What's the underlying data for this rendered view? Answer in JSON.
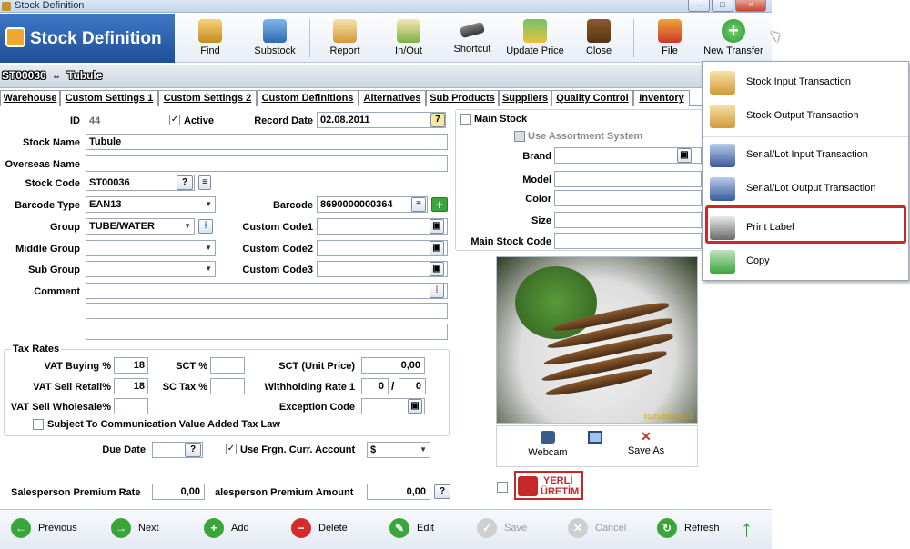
{
  "window": {
    "title": "Stock Definition",
    "min": "–",
    "max": "□",
    "close": "×"
  },
  "banner": {
    "title": "Stock Definition"
  },
  "toolbar": [
    {
      "label": "Find"
    },
    {
      "label": "Substock"
    },
    {
      "label": "Report"
    },
    {
      "label": "In/Out"
    },
    {
      "label": "Shortcut"
    },
    {
      "label": "Update Price"
    },
    {
      "label": "Close"
    },
    {
      "label": "File"
    },
    {
      "label": "New Transfer"
    }
  ],
  "stock": {
    "code": "ST00036",
    "dash": "-",
    "name": "Tubule"
  },
  "tabs": [
    "Warehouse",
    "Custom Settings 1",
    "Custom Settings 2",
    "Custom Definitions",
    "Alternatives",
    "Sub Products",
    "Suppliers",
    "Quality Control",
    "Inventory"
  ],
  "form": {
    "id_label": "ID",
    "id_value": "44",
    "active_label": "Active",
    "record_date_label": "Record Date",
    "record_date": "02.08.2011",
    "stock_name_label": "Stock Name",
    "stock_name": "Tubule",
    "overseas_name_label": "Overseas Name",
    "stock_code_label": "Stock Code",
    "stock_code": "ST00036",
    "barcode_type_label": "Barcode Type",
    "barcode_type": "EAN13",
    "barcode_label": "Barcode",
    "barcode": "8690000000364",
    "group_label": "Group",
    "group": "TUBE/WATER",
    "middle_group_label": "Middle Group",
    "sub_group_label": "Sub Group",
    "custom_code1_label": "Custom Code1",
    "custom_code2_label": "Custom Code2",
    "custom_code3_label": "Custom Code3",
    "comment_label": "Comment",
    "question_mark": "?"
  },
  "right": {
    "main_stock_label": "Main Stock",
    "use_assortment_label": "Use Assortment System",
    "brand_label": "Brand",
    "model_label": "Model",
    "color_label": "Color",
    "size_label": "Size",
    "main_stock_code_label": "Main Stock Code",
    "webcam_label": "Webcam",
    "save_as_label": "Save As",
    "photo_stamp": "01/01/2008 01:01",
    "yerli_line1": "YERLİ",
    "yerli_line2": "ÜRETİM"
  },
  "tax": {
    "title": "Tax Rates",
    "vat_buying_label": "VAT Buying %",
    "vat_buying": "18",
    "vat_sell_retail_label": "VAT Sell Retail%",
    "vat_sell_retail": "18",
    "vat_sell_wholesale_label": "VAT Sell Wholesale%",
    "sct_label": "SCT %",
    "sc_tax_label": "SC Tax %",
    "sct_unit_label": "SCT (Unit Price)",
    "sct_unit": "0,00",
    "withholding_label": "Withholding Rate 1",
    "withholding_a": "0",
    "withholding_sep": "/",
    "withholding_b": "0",
    "exception_label": "Exception Code",
    "subject_label": "Subject To Communication Value Added Tax Law"
  },
  "misc": {
    "due_date_label": "Due Date",
    "use_frgn_label": "Use Frgn. Curr. Account",
    "currency": "$",
    "sp_rate_label": "Salesperson Premium Rate",
    "sp_rate": "0,00",
    "sp_amount_label": "alesperson Premium Amount",
    "sp_amount": "0,00"
  },
  "bottom": [
    {
      "label": "Previous"
    },
    {
      "label": "Next"
    },
    {
      "label": "Add"
    },
    {
      "label": "Delete"
    },
    {
      "label": "Edit"
    },
    {
      "label": "Save"
    },
    {
      "label": "Cancel"
    },
    {
      "label": "Refresh"
    }
  ],
  "menu": [
    {
      "label": "Stock Input Transaction"
    },
    {
      "label": "Stock Output Transaction"
    },
    {
      "label": "Serial/Lot Input Transaction"
    },
    {
      "label": "Serial/Lot Output Transaction"
    },
    {
      "label": "Print Label"
    },
    {
      "label": "Copy"
    }
  ],
  "colors": {
    "banner": "#2a5ba8",
    "highlight": "#d6232a",
    "accent_green": "#3aa63a"
  }
}
